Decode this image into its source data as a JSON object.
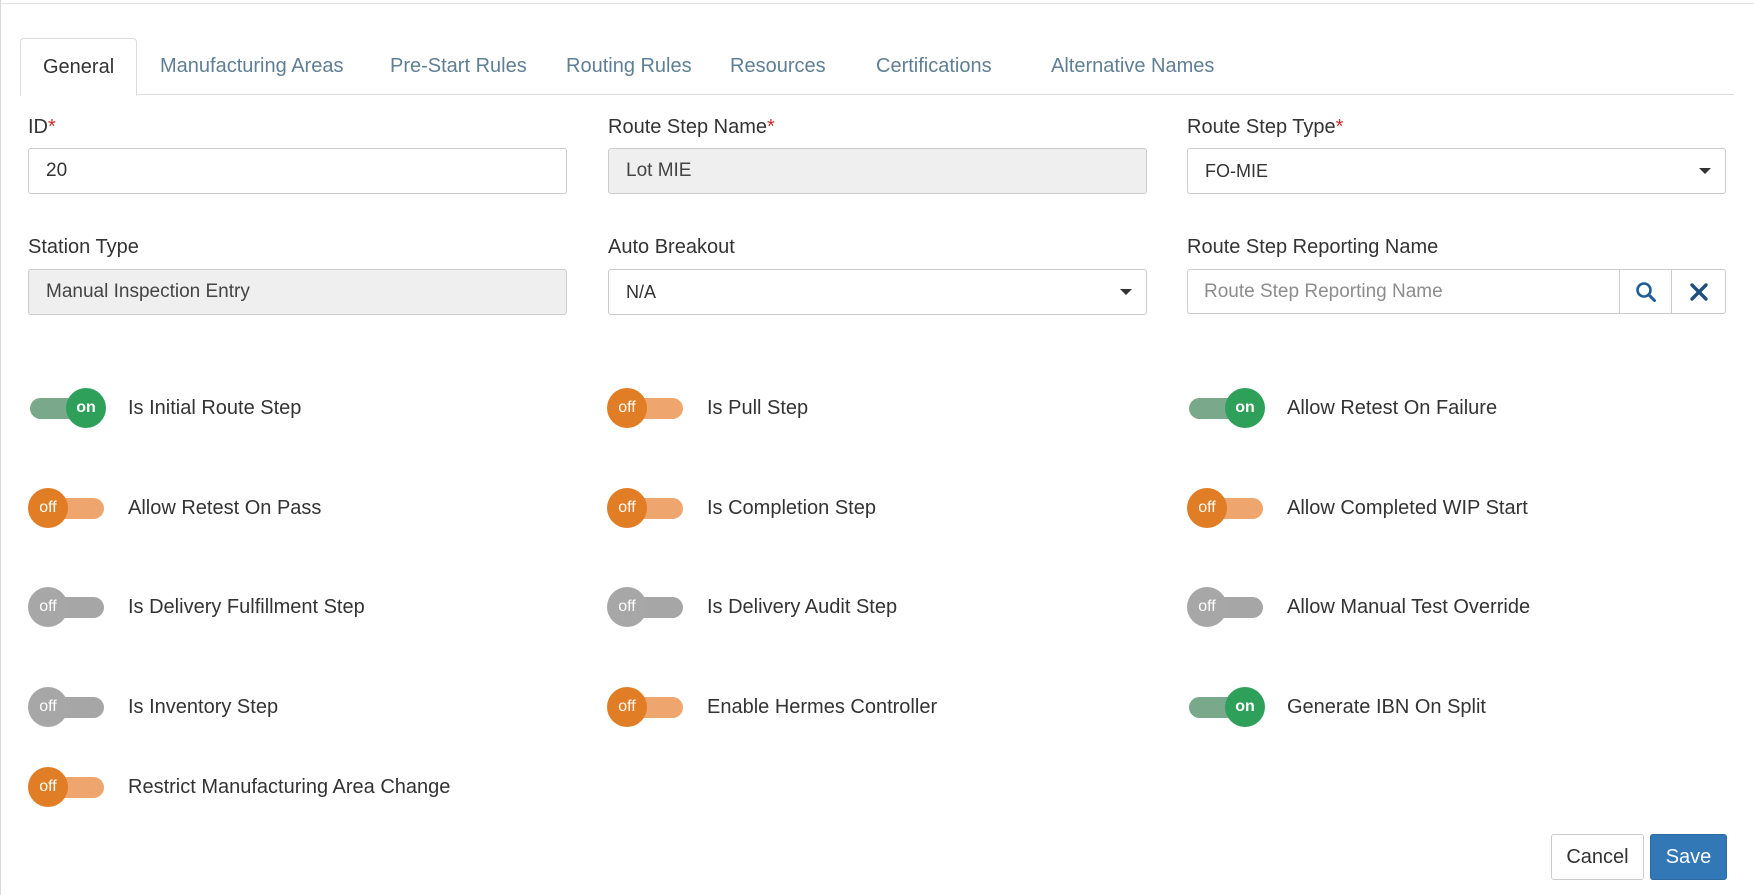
{
  "tabs": [
    {
      "label": "General",
      "active": true
    },
    {
      "label": "Manufacturing Areas",
      "active": false
    },
    {
      "label": "Pre-Start Rules",
      "active": false
    },
    {
      "label": "Routing Rules",
      "active": false
    },
    {
      "label": "Resources",
      "active": false
    },
    {
      "label": "Certifications",
      "active": false
    },
    {
      "label": "Alternative Names",
      "active": false
    }
  ],
  "fields": {
    "id": {
      "label": "ID",
      "required_mark": "*",
      "value": "20"
    },
    "route_step_name": {
      "label": "Route Step Name",
      "required_mark": "*",
      "value": "Lot MIE"
    },
    "route_step_type": {
      "label": "Route Step Type",
      "required_mark": "*",
      "value": "FO-MIE"
    },
    "station_type": {
      "label": "Station Type",
      "value": "Manual Inspection Entry"
    },
    "auto_breakout": {
      "label": "Auto Breakout",
      "value": "N/A"
    },
    "route_step_reporting_name": {
      "label": "Route Step Reporting Name",
      "value": "",
      "placeholder": "Route Step Reporting Name"
    }
  },
  "toggles": [
    {
      "label": "Is Initial Route Step",
      "state": "on",
      "style": "on"
    },
    {
      "label": "Is Pull Step",
      "state": "off",
      "style": "off-orange"
    },
    {
      "label": "Allow Retest On Failure",
      "state": "on",
      "style": "on"
    },
    {
      "label": "Allow Retest On Pass",
      "state": "off",
      "style": "off-orange"
    },
    {
      "label": "Is Completion Step",
      "state": "off",
      "style": "off-orange"
    },
    {
      "label": "Allow Completed WIP Start",
      "state": "off",
      "style": "off-orange"
    },
    {
      "label": "Is Delivery Fulfillment Step",
      "state": "off",
      "style": "off-gray"
    },
    {
      "label": "Is Delivery Audit Step",
      "state": "off",
      "style": "off-gray"
    },
    {
      "label": "Allow Manual Test Override",
      "state": "off",
      "style": "off-gray"
    },
    {
      "label": "Is Inventory Step",
      "state": "off",
      "style": "off-gray"
    },
    {
      "label": "Enable Hermes Controller",
      "state": "off",
      "style": "off-orange"
    },
    {
      "label": "Generate IBN On Split",
      "state": "on",
      "style": "on"
    },
    {
      "label": "Restrict Manufacturing Area Change",
      "state": "off",
      "style": "off-orange"
    }
  ],
  "icons": {
    "search": "search-icon",
    "clear": "close-icon",
    "dropdown": "chevron-down-icon"
  },
  "colors": {
    "on": "#2ea05a",
    "off_orange": "#e07d25",
    "off_gray": "#a7a7a7",
    "primary": "#3277b6",
    "required": "#c9302c",
    "tab_link": "#5f7f95"
  },
  "actions": {
    "cancel_label": "Cancel",
    "save_label": "Save"
  }
}
